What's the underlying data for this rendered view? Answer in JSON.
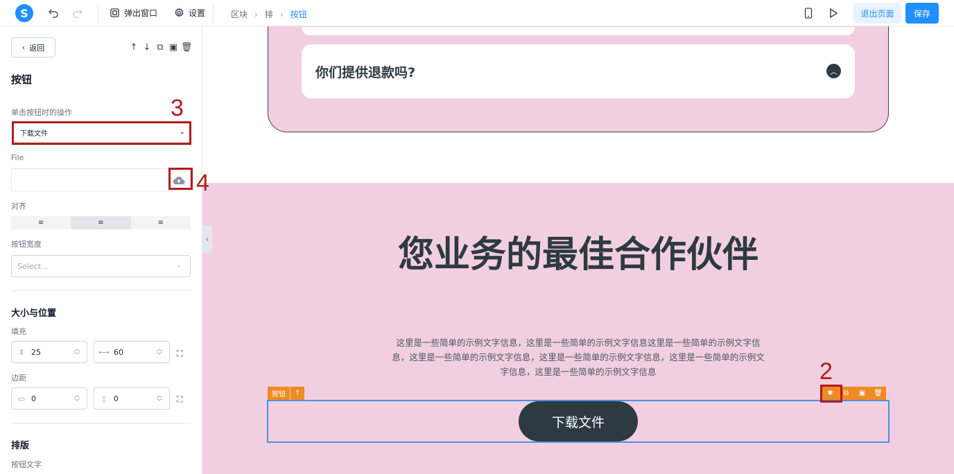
{
  "topbar": {
    "logo": "S",
    "undo_icon": "undo-icon",
    "redo_icon": "redo-icon",
    "popup_label": "弹出窗口",
    "settings_label": "设置",
    "breadcrumbs": [
      "区块",
      "排",
      "按钮"
    ],
    "exit_label": "退出页面",
    "save_label": "保存",
    "accent": "#1e90ff"
  },
  "panel": {
    "back_label": "返回",
    "title": "按钮",
    "action_label": "单击按钮时的操作",
    "action_value": "下载文件",
    "file_label": "File",
    "align_label": "对齐",
    "width_label": "按钮宽度",
    "width_placeholder": "Select...",
    "size_section": "大小与位置",
    "padding_label": "填充",
    "padding_vertical": "25",
    "padding_horizontal": "60",
    "margin_label": "边距",
    "margin_vertical": "0",
    "margin_horizontal": "0",
    "layout_section": "排版",
    "button_text_label": "按钮文字"
  },
  "annotations": {
    "n2": "2",
    "n3": "3",
    "n4": "4",
    "color": "#b01c1c"
  },
  "canvas": {
    "faq_question": "你们提供退款吗?",
    "hero_title": "您业务的最佳合作伙伴",
    "hero_text": "这里是一些简单的示例文字信息，这里是一些简单的示例文字信息这里是一些简单的示例文字信息，这里是一些简单的示例文字信息，这里是一些简单的示例文字信息，这里是一些简单的示例文字信息，这里是一些简单的示例文字信息",
    "selected_tag": "按钮",
    "download_button": "下载文件",
    "section_bg": "#f2cfe0",
    "toolbar_color": "#f08a24"
  }
}
